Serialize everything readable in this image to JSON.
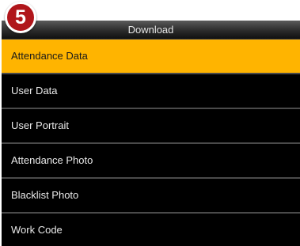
{
  "step_badge": "5",
  "header": {
    "title": "Download"
  },
  "menu": {
    "items": [
      {
        "label": "Attendance Data",
        "selected": true
      },
      {
        "label": "User Data",
        "selected": false
      },
      {
        "label": "User Portrait",
        "selected": false
      },
      {
        "label": "Attendance Photo",
        "selected": false
      },
      {
        "label": "Blacklist Photo",
        "selected": false
      },
      {
        "label": "Work Code",
        "selected": false
      }
    ]
  },
  "colors": {
    "selection_highlight": "#ffb400",
    "badge": "#b0161b",
    "background": "#000000"
  }
}
